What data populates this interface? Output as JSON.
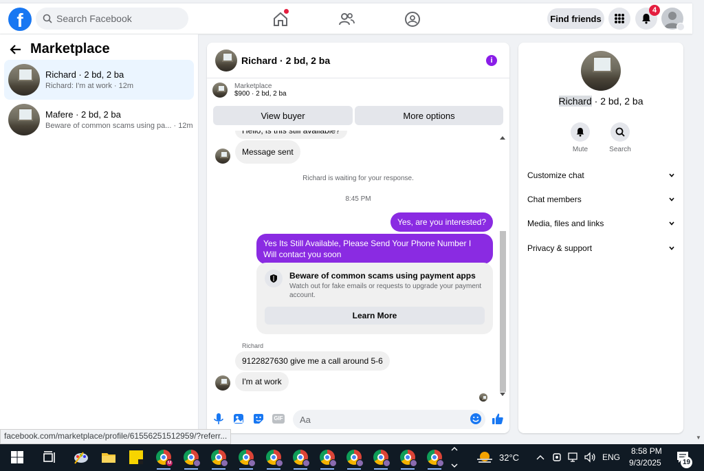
{
  "header": {
    "logo": "f",
    "search_placeholder": "Search Facebook",
    "find_friends": "Find friends",
    "notification_count": "4"
  },
  "left": {
    "title": "Marketplace",
    "conversations": [
      {
        "title": "Richard · 2 bd, 2 ba",
        "preview": "Richard: I'm at work · 12m",
        "active": true
      },
      {
        "title": "Mafere · 2 bd, 2 ba",
        "preview": "Beware of common scams using pa... · 12m",
        "active": false
      }
    ]
  },
  "chat": {
    "title": "Richard · 2 bd, 2 ba",
    "marketplace_label": "Marketplace",
    "listing": "$900 · 2 bd, 2 ba",
    "view_buyer": "View buyer",
    "more_options": "More options",
    "partial_message": "Hello, is this still available?",
    "message_sent": "Message sent",
    "waiting": "Richard is waiting for your response.",
    "time": "8:45 PM",
    "out_1": "Yes, are you interested?",
    "out_2": "Yes Its Still Available, Please Send Your Phone Number I Will contact you soon",
    "scam_title": "Beware of common scams using payment apps",
    "scam_desc": "Watch out for fake emails or requests to upgrade your payment account.",
    "learn_more": "Learn More",
    "sender": "Richard",
    "in_1": "9122827630 give me a call around 5-6",
    "in_2": "I'm at work",
    "composer_placeholder": "Aa",
    "gif": "GIF"
  },
  "right": {
    "name_highlight": "Richard",
    "name_rest": " · 2 bd, 2 ba",
    "mute": "Mute",
    "search": "Search",
    "rows": [
      "Customize chat",
      "Chat members",
      "Media, files and links",
      "Privacy & support"
    ]
  },
  "status_url": "facebook.com/marketplace/profile/61556251512959/?referr...",
  "taskbar": {
    "temperature": "32°C",
    "lang": "ENG",
    "time": "8:58 PM",
    "date": "9/3/2025",
    "notif_count": "19"
  },
  "colors": {
    "brand": "#1877f2",
    "accent": "#8a2be2",
    "badge": "#e41e3f"
  }
}
